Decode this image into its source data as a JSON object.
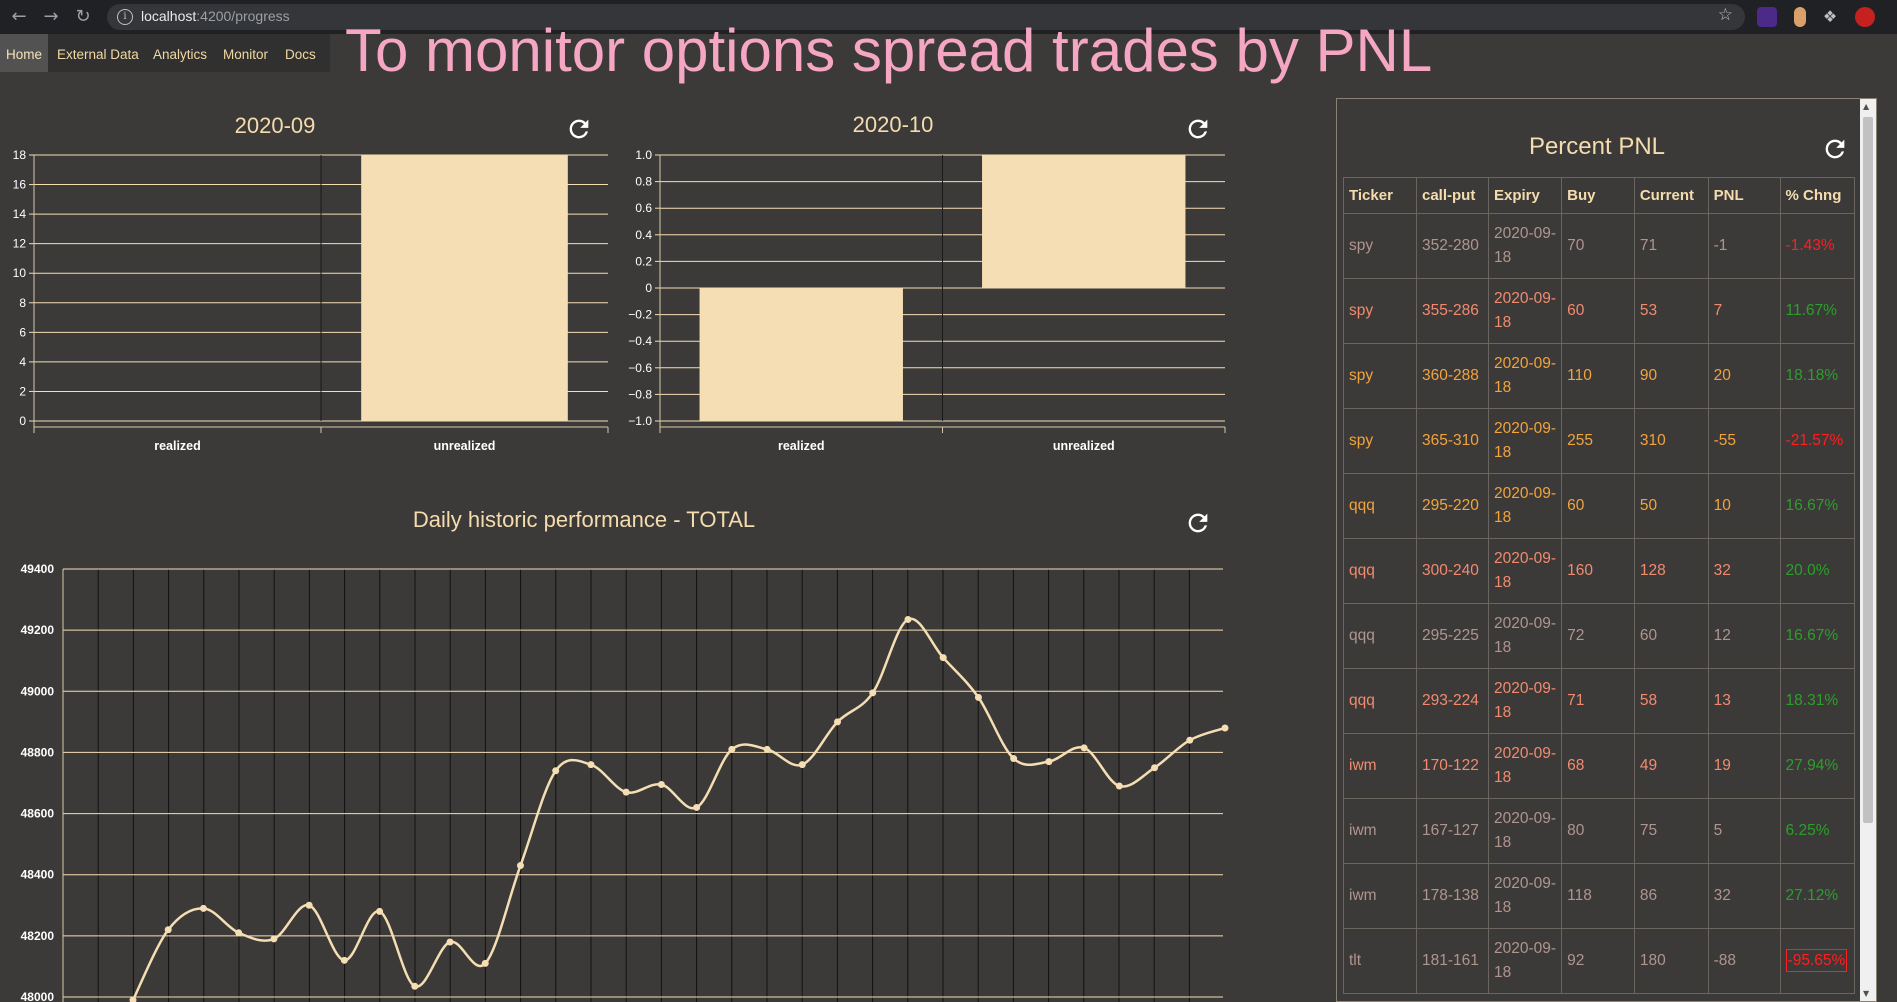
{
  "browser": {
    "url_host": "localhost",
    "url_path": ":4200/progress"
  },
  "appnav": {
    "items": [
      {
        "label": "Home",
        "active": true
      },
      {
        "label": "External Data"
      },
      {
        "label": "Analytics"
      },
      {
        "label": "Monitor"
      },
      {
        "label": "Docs"
      }
    ]
  },
  "headline": "To monitor options spread trades by PNL",
  "colors": {
    "page_bg": "#3c3a39",
    "bar_fill": "#f5deb3",
    "grid": "#f5deb3",
    "headline": "#f4a6c3",
    "positive": "#2aa02a",
    "negative": "#ff1f1f"
  },
  "chart_data": [
    {
      "type": "bar",
      "title": "2020-09",
      "categories": [
        "realized",
        "unrealized"
      ],
      "values": [
        0,
        18
      ],
      "ylim": [
        0,
        18
      ],
      "yticks": [
        "0",
        "2",
        "4",
        "6",
        "8",
        "10",
        "12",
        "14",
        "16",
        "18"
      ],
      "grid": true
    },
    {
      "type": "bar",
      "title": "2020-10",
      "categories": [
        "realized",
        "unrealized"
      ],
      "values": [
        -1,
        1
      ],
      "ylim": [
        -1,
        1
      ],
      "yticks": [
        "−1.0",
        "−0.8",
        "−0.6",
        "−0.4",
        "−0.2",
        "0",
        "0.2",
        "0.4",
        "0.6",
        "0.8",
        "1.0"
      ],
      "grid": true
    },
    {
      "type": "line",
      "title": "Daily historic performance - TOTAL",
      "ylim": [
        48000,
        49400
      ],
      "yticks": [
        "48000",
        "48200",
        "48400",
        "48600",
        "48800",
        "49000",
        "49200",
        "49400"
      ],
      "values": [
        47990,
        48220,
        48290,
        48210,
        48190,
        48300,
        48120,
        48280,
        48035,
        48180,
        48110,
        48430,
        48740,
        48760,
        48670,
        48695,
        48620,
        48810,
        48810,
        48760,
        48900,
        48995,
        49235,
        49110,
        48980,
        48780,
        48770,
        48815,
        48690,
        48750,
        48840,
        48880
      ],
      "grid": true,
      "smooth": true
    }
  ],
  "pnl": {
    "title": "Percent PNL",
    "columns": [
      "Ticker",
      "call-put",
      "Expiry",
      "Buy",
      "Current",
      "PNL",
      "% Chng"
    ],
    "rows": [
      {
        "ticker": "spy",
        "spread": "352-280",
        "expiry": "2020-09-18",
        "buy": "70",
        "current": "71",
        "pnl": "-1",
        "chng": "-1.43%",
        "color": "#b0958f",
        "sign": "neg"
      },
      {
        "ticker": "spy",
        "spread": "355-286",
        "expiry": "2020-09-18",
        "buy": "60",
        "current": "53",
        "pnl": "7",
        "chng": "11.67%",
        "color": "#f28b6e",
        "sign": "pos"
      },
      {
        "ticker": "spy",
        "spread": "360-288",
        "expiry": "2020-09-18",
        "buy": "110",
        "current": "90",
        "pnl": "20",
        "chng": "18.18%",
        "color": "#f2a33c",
        "sign": "pos"
      },
      {
        "ticker": "spy",
        "spread": "365-310",
        "expiry": "2020-09-18",
        "buy": "255",
        "current": "310",
        "pnl": "-55",
        "chng": "-21.57%",
        "color": "#f2a33c",
        "sign": "neg"
      },
      {
        "ticker": "qqq",
        "spread": "295-220",
        "expiry": "2020-09-18",
        "buy": "60",
        "current": "50",
        "pnl": "10",
        "chng": "16.67%",
        "color": "#f2a33c",
        "sign": "pos"
      },
      {
        "ticker": "qqq",
        "spread": "300-240",
        "expiry": "2020-09-18",
        "buy": "160",
        "current": "128",
        "pnl": "32",
        "chng": "20.0%",
        "color": "#f28b6e",
        "sign": "pos"
      },
      {
        "ticker": "qqq",
        "spread": "295-225",
        "expiry": "2020-09-18",
        "buy": "72",
        "current": "60",
        "pnl": "12",
        "chng": "16.67%",
        "color": "#b0958f",
        "sign": "pos"
      },
      {
        "ticker": "qqq",
        "spread": "293-224",
        "expiry": "2020-09-18",
        "buy": "71",
        "current": "58",
        "pnl": "13",
        "chng": "18.31%",
        "color": "#f28b6e",
        "sign": "pos"
      },
      {
        "ticker": "iwm",
        "spread": "170-122",
        "expiry": "2020-09-18",
        "buy": "68",
        "current": "49",
        "pnl": "19",
        "chng": "27.94%",
        "color": "#f28b6e",
        "sign": "pos"
      },
      {
        "ticker": "iwm",
        "spread": "167-127",
        "expiry": "2020-09-18",
        "buy": "80",
        "current": "75",
        "pnl": "5",
        "chng": "6.25%",
        "color": "#b0958f",
        "sign": "pos"
      },
      {
        "ticker": "iwm",
        "spread": "178-138",
        "expiry": "2020-09-18",
        "buy": "118",
        "current": "86",
        "pnl": "32",
        "chng": "27.12%",
        "color": "#b0958f",
        "sign": "pos"
      },
      {
        "ticker": "tlt",
        "spread": "181-161",
        "expiry": "2020-09-18",
        "buy": "92",
        "current": "180",
        "pnl": "-88",
        "chng": "-95.65%",
        "color": "#b0958f",
        "sign": "neg",
        "boxed": true
      }
    ]
  }
}
